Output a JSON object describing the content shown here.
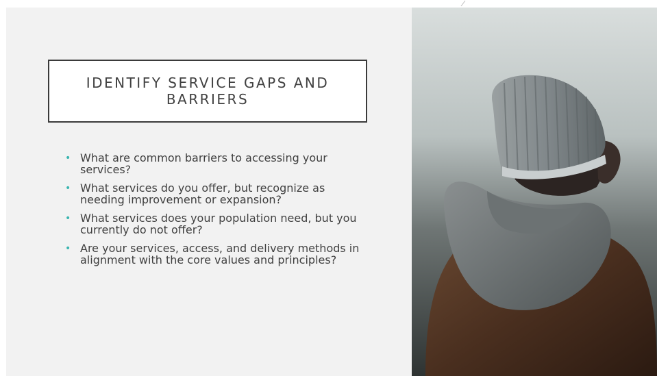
{
  "slide": {
    "title": "IDENTIFY SERVICE GAPS AND BARRIERS",
    "bullets": [
      "What are common barriers to accessing your services?",
      "What services do you offer, but recognize as needing improvement or expansion?",
      "What services does your population need, but you currently do not offer?",
      "Are your services, access, and delivery methods in alignment with the core values and principles?"
    ],
    "bullet_glyph": "•",
    "photo_icon": "person-in-beanie-photo"
  },
  "colors": {
    "background": "#f2f2f2",
    "title_border": "#3a3a3a",
    "text": "#404040",
    "bullet_accent": "#3ab5b0"
  }
}
